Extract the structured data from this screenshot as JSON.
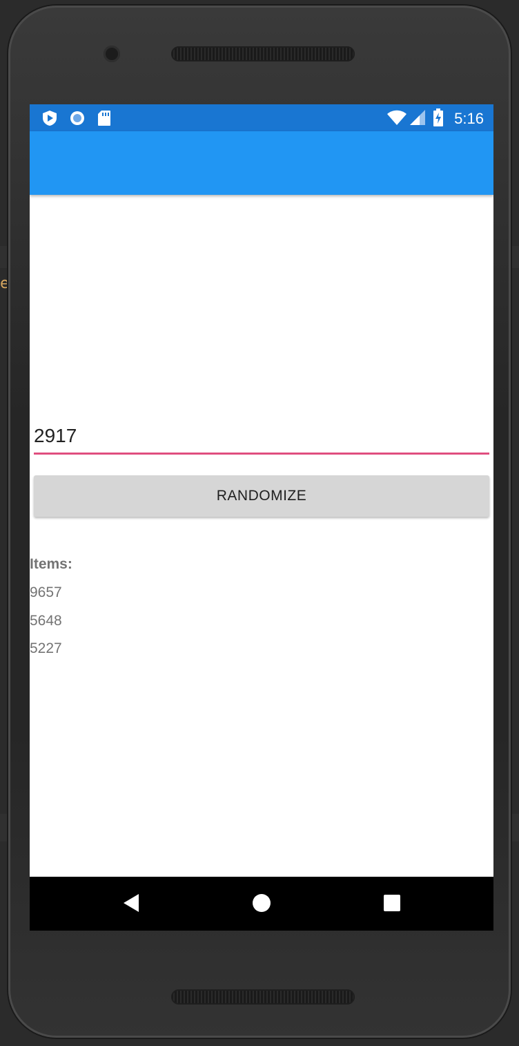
{
  "status_bar": {
    "time": "5:16",
    "left_icons": [
      "shield-play-icon",
      "circle-icon",
      "sd-card-icon"
    ],
    "right_icons": [
      "wifi-icon",
      "signal-icon",
      "battery-charging-icon"
    ]
  },
  "form": {
    "entry_value": "2917",
    "button_label": "RANDOMIZE"
  },
  "list": {
    "heading": "Items:",
    "items": [
      "9657",
      "5648",
      "5227"
    ]
  },
  "nav_bar": {
    "icons": [
      "back-icon",
      "home-icon",
      "recents-icon"
    ]
  },
  "colors": {
    "status_bar": "#1976d2",
    "app_bar": "#2196f3",
    "entry_underline": "#e04e7f",
    "button_background": "#d6d6d6",
    "list_text": "#737373"
  }
}
